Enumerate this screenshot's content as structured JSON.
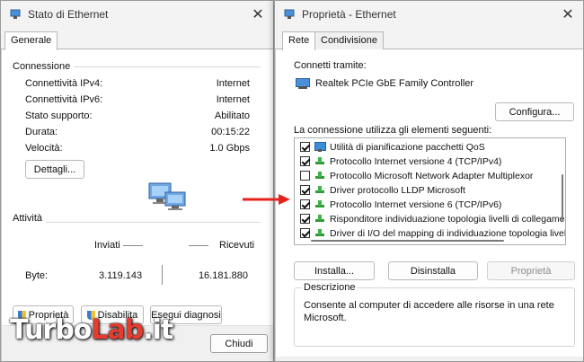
{
  "left_window": {
    "title": "Stato di Ethernet",
    "tab_general": "Generale",
    "connection": {
      "title": "Connessione",
      "rows": [
        {
          "label": "Connettività IPv4:",
          "value": "Internet"
        },
        {
          "label": "Connettività IPv6:",
          "value": "Internet"
        },
        {
          "label": "Stato supporto:",
          "value": "Abilitato"
        },
        {
          "label": "Durata:",
          "value": "00:15:22"
        },
        {
          "label": "Velocità:",
          "value": "1.0 Gbps"
        }
      ],
      "details_button": "Dettagli..."
    },
    "activity": {
      "title": "Attività",
      "sent_label": "Inviati",
      "received_label": "Ricevuti",
      "bytes_label": "Byte:",
      "bytes_sent": "3.119.143",
      "bytes_received": "16.181.880"
    },
    "buttons": {
      "properties": "Proprietà",
      "disable": "Disabilita",
      "diagnose": "Esegui diagnosi"
    },
    "close_button": "Chiudi"
  },
  "right_window": {
    "title": "Proprietà - Ethernet",
    "tab_network": "Rete",
    "tab_sharing": "Condivisione",
    "connect_using_label": "Connetti tramite:",
    "adapter_name": "Realtek PCIe GbE Family Controller",
    "configure_button": "Configura...",
    "items_label": "La connessione utilizza gli elementi seguenti:",
    "items": [
      {
        "label": "Utilità di pianificazione pacchetti QoS",
        "checked": true,
        "icon": "qos-monitor-icon"
      },
      {
        "label": "Protocollo Internet versione 4 (TCP/IPv4)",
        "checked": true,
        "icon": "protocol-icon"
      },
      {
        "label": "Protocollo Microsoft Network Adapter Multiplexor",
        "checked": false,
        "icon": "protocol-icon"
      },
      {
        "label": "Driver protocollo LLDP Microsoft",
        "checked": true,
        "icon": "protocol-icon"
      },
      {
        "label": "Protocollo Internet versione 6 (TCP/IPv6)",
        "checked": true,
        "icon": "protocol-icon"
      },
      {
        "label": "Risponditore individuazione topologia livelli di collegamento",
        "checked": true,
        "icon": "protocol-icon"
      },
      {
        "label": "Driver di I/O del mapping di individuazione topologia livelli d",
        "checked": true,
        "icon": "protocol-icon"
      }
    ],
    "install_button": "Installa...",
    "uninstall_button": "Disinstalla",
    "properties_button": "Proprietà",
    "description_title": "Descrizione",
    "description_text": "Consente al computer di accedere alle risorse in una rete Microsoft."
  },
  "watermark": {
    "part1": "Turbo",
    "part2": "Lab",
    "part3": ".it"
  },
  "colors": {
    "arrow": "#e3231c",
    "accent_red": "#e63b2e",
    "protocol_green": "#3db546",
    "adapter_blue": "#4a90d9"
  }
}
